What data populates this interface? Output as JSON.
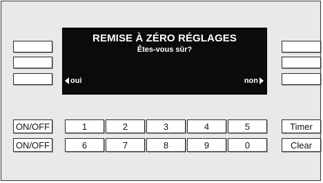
{
  "display": {
    "title": "REMISE À ZÉRO RÉGLAGES",
    "subtitle": "Êtes-vous sûr?",
    "soft_left": "oui",
    "soft_right": "non"
  },
  "left_column": {
    "onoff_1": "ON/OFF",
    "onoff_2": "ON/OFF"
  },
  "keypad": {
    "row1": [
      "1",
      "2",
      "3",
      "4",
      "5"
    ],
    "row2": [
      "6",
      "7",
      "8",
      "9",
      "0"
    ]
  },
  "right_column": {
    "timer": "Timer",
    "clear": "Clear"
  },
  "colors": {
    "panel": "#e9e9ea",
    "screen": "#0b0b0b",
    "screen_text": "#ffffff",
    "button": "#ffffff",
    "outline": "#2a2a2a"
  },
  "icons": {
    "soft_left": "triangle-left-icon",
    "soft_right": "triangle-right-icon"
  }
}
